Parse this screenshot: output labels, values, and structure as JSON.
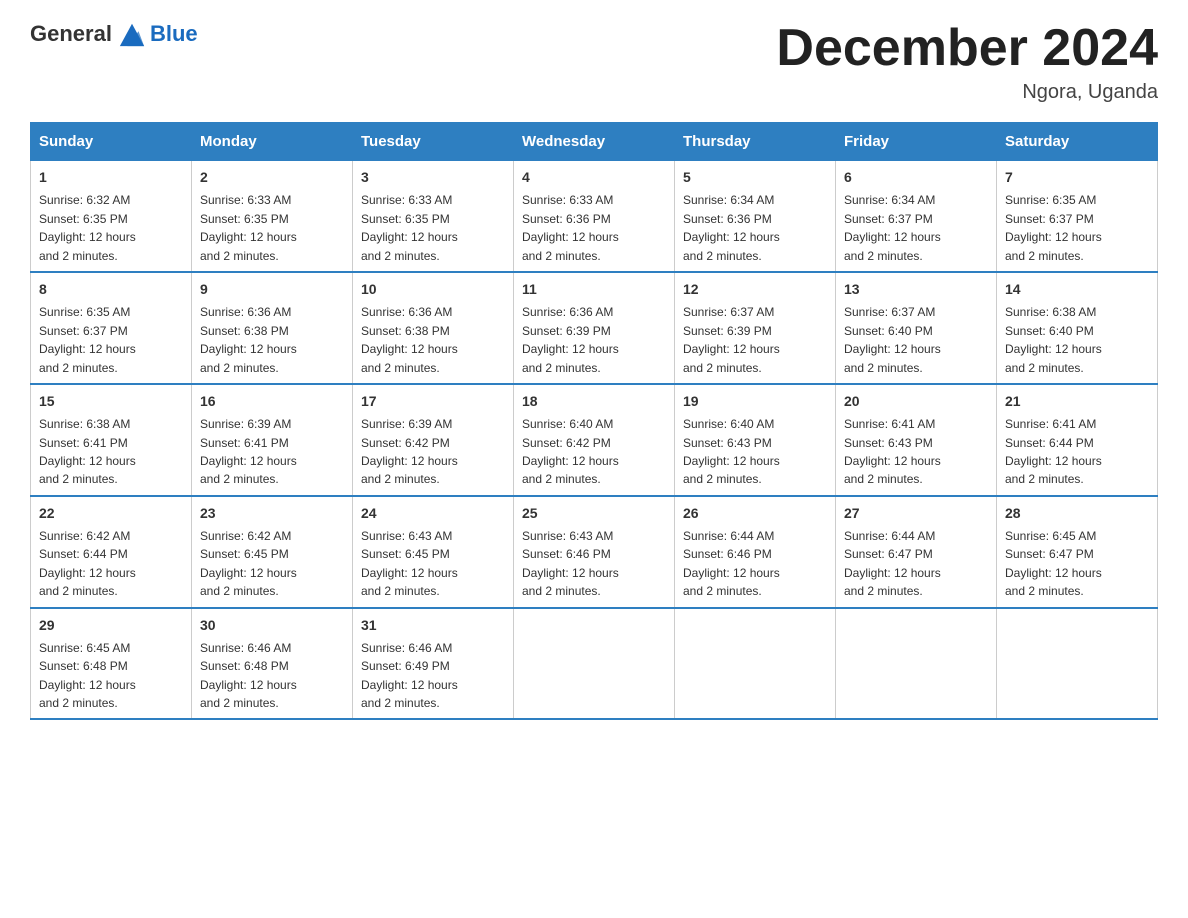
{
  "header": {
    "logo_general": "General",
    "logo_blue": "Blue",
    "month_title": "December 2024",
    "location": "Ngora, Uganda"
  },
  "days_of_week": [
    "Sunday",
    "Monday",
    "Tuesday",
    "Wednesday",
    "Thursday",
    "Friday",
    "Saturday"
  ],
  "weeks": [
    [
      {
        "day": "1",
        "sunrise": "6:32 AM",
        "sunset": "6:35 PM",
        "daylight": "12 hours and 2 minutes."
      },
      {
        "day": "2",
        "sunrise": "6:33 AM",
        "sunset": "6:35 PM",
        "daylight": "12 hours and 2 minutes."
      },
      {
        "day": "3",
        "sunrise": "6:33 AM",
        "sunset": "6:35 PM",
        "daylight": "12 hours and 2 minutes."
      },
      {
        "day": "4",
        "sunrise": "6:33 AM",
        "sunset": "6:36 PM",
        "daylight": "12 hours and 2 minutes."
      },
      {
        "day": "5",
        "sunrise": "6:34 AM",
        "sunset": "6:36 PM",
        "daylight": "12 hours and 2 minutes."
      },
      {
        "day": "6",
        "sunrise": "6:34 AM",
        "sunset": "6:37 PM",
        "daylight": "12 hours and 2 minutes."
      },
      {
        "day": "7",
        "sunrise": "6:35 AM",
        "sunset": "6:37 PM",
        "daylight": "12 hours and 2 minutes."
      }
    ],
    [
      {
        "day": "8",
        "sunrise": "6:35 AM",
        "sunset": "6:37 PM",
        "daylight": "12 hours and 2 minutes."
      },
      {
        "day": "9",
        "sunrise": "6:36 AM",
        "sunset": "6:38 PM",
        "daylight": "12 hours and 2 minutes."
      },
      {
        "day": "10",
        "sunrise": "6:36 AM",
        "sunset": "6:38 PM",
        "daylight": "12 hours and 2 minutes."
      },
      {
        "day": "11",
        "sunrise": "6:36 AM",
        "sunset": "6:39 PM",
        "daylight": "12 hours and 2 minutes."
      },
      {
        "day": "12",
        "sunrise": "6:37 AM",
        "sunset": "6:39 PM",
        "daylight": "12 hours and 2 minutes."
      },
      {
        "day": "13",
        "sunrise": "6:37 AM",
        "sunset": "6:40 PM",
        "daylight": "12 hours and 2 minutes."
      },
      {
        "day": "14",
        "sunrise": "6:38 AM",
        "sunset": "6:40 PM",
        "daylight": "12 hours and 2 minutes."
      }
    ],
    [
      {
        "day": "15",
        "sunrise": "6:38 AM",
        "sunset": "6:41 PM",
        "daylight": "12 hours and 2 minutes."
      },
      {
        "day": "16",
        "sunrise": "6:39 AM",
        "sunset": "6:41 PM",
        "daylight": "12 hours and 2 minutes."
      },
      {
        "day": "17",
        "sunrise": "6:39 AM",
        "sunset": "6:42 PM",
        "daylight": "12 hours and 2 minutes."
      },
      {
        "day": "18",
        "sunrise": "6:40 AM",
        "sunset": "6:42 PM",
        "daylight": "12 hours and 2 minutes."
      },
      {
        "day": "19",
        "sunrise": "6:40 AM",
        "sunset": "6:43 PM",
        "daylight": "12 hours and 2 minutes."
      },
      {
        "day": "20",
        "sunrise": "6:41 AM",
        "sunset": "6:43 PM",
        "daylight": "12 hours and 2 minutes."
      },
      {
        "day": "21",
        "sunrise": "6:41 AM",
        "sunset": "6:44 PM",
        "daylight": "12 hours and 2 minutes."
      }
    ],
    [
      {
        "day": "22",
        "sunrise": "6:42 AM",
        "sunset": "6:44 PM",
        "daylight": "12 hours and 2 minutes."
      },
      {
        "day": "23",
        "sunrise": "6:42 AM",
        "sunset": "6:45 PM",
        "daylight": "12 hours and 2 minutes."
      },
      {
        "day": "24",
        "sunrise": "6:43 AM",
        "sunset": "6:45 PM",
        "daylight": "12 hours and 2 minutes."
      },
      {
        "day": "25",
        "sunrise": "6:43 AM",
        "sunset": "6:46 PM",
        "daylight": "12 hours and 2 minutes."
      },
      {
        "day": "26",
        "sunrise": "6:44 AM",
        "sunset": "6:46 PM",
        "daylight": "12 hours and 2 minutes."
      },
      {
        "day": "27",
        "sunrise": "6:44 AM",
        "sunset": "6:47 PM",
        "daylight": "12 hours and 2 minutes."
      },
      {
        "day": "28",
        "sunrise": "6:45 AM",
        "sunset": "6:47 PM",
        "daylight": "12 hours and 2 minutes."
      }
    ],
    [
      {
        "day": "29",
        "sunrise": "6:45 AM",
        "sunset": "6:48 PM",
        "daylight": "12 hours and 2 minutes."
      },
      {
        "day": "30",
        "sunrise": "6:46 AM",
        "sunset": "6:48 PM",
        "daylight": "12 hours and 2 minutes."
      },
      {
        "day": "31",
        "sunrise": "6:46 AM",
        "sunset": "6:49 PM",
        "daylight": "12 hours and 2 minutes."
      },
      null,
      null,
      null,
      null
    ]
  ],
  "labels": {
    "sunrise": "Sunrise:",
    "sunset": "Sunset:",
    "daylight": "Daylight: 12 hours"
  }
}
